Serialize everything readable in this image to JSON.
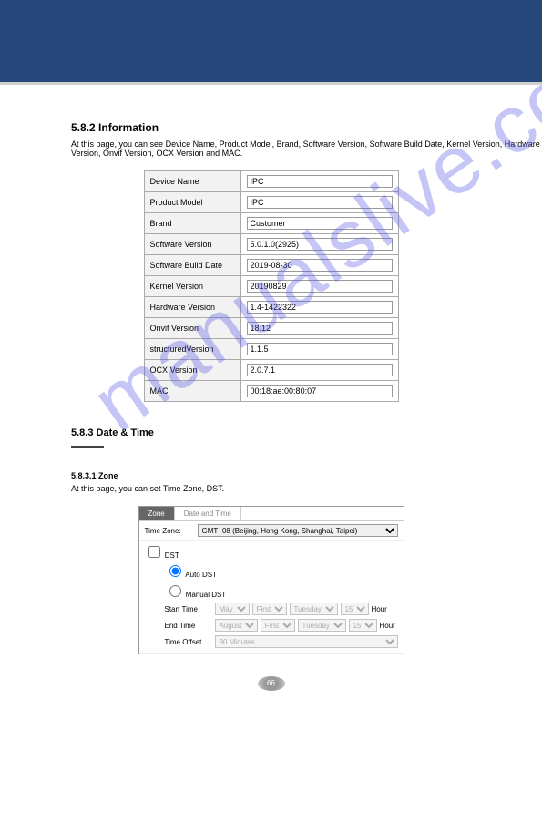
{
  "header": {},
  "watermark": "manualslive.com",
  "section1": {
    "title": "5.8.2 Information",
    "desc": "At this page, you can see Device Name, Product Model, Brand, Software Version, Software Build Date, Kernel Version, Hardware Version, Onvif Version, OCX Version and MAC.",
    "rows": [
      {
        "label": "Device Name",
        "value": "IPC"
      },
      {
        "label": "Product Model",
        "value": "IPC"
      },
      {
        "label": "Brand",
        "value": "Customer"
      },
      {
        "label": "Software Version",
        "value": "5.0.1.0(2925)"
      },
      {
        "label": "Software Build Date",
        "value": "2019-08-30"
      },
      {
        "label": "Kernel Version",
        "value": "20190829"
      },
      {
        "label": "Hardware Version",
        "value": "1.4-1422322"
      },
      {
        "label": "Onvif Version",
        "value": "18.12"
      },
      {
        "label": "structuredVersion",
        "value": "1.1.5"
      },
      {
        "label": "OCX Version",
        "value": "2.0.7.1"
      },
      {
        "label": "MAC",
        "value": "00:18:ae:00:80:07"
      }
    ]
  },
  "section2": {
    "heading": "5.8.3 Date & Time",
    "sub": "5.8.3.1 Zone",
    "desc": "At this page, you can set Time Zone, DST."
  },
  "time": {
    "tabs": {
      "zone": "Zone",
      "dt": "Date and Time"
    },
    "tzLabel": "Time Zone:",
    "tzValue": "GMT+08 (Beijing, Hong Kong, Shanghai, Taipei)",
    "dst": "DST",
    "auto": "Auto DST",
    "manual": "Manual DST",
    "start": "Start Time",
    "end": "End Time",
    "offset": "Time Offset",
    "sel": {
      "month1": "May",
      "week1": "First",
      "day1": "Tuesday",
      "hour1": "15",
      "month2": "August",
      "week2": "First",
      "day2": "Tuesday",
      "hour2": "15",
      "off": "30 Minutes",
      "hourUnit": "Hour"
    }
  },
  "pageNumber": "66"
}
